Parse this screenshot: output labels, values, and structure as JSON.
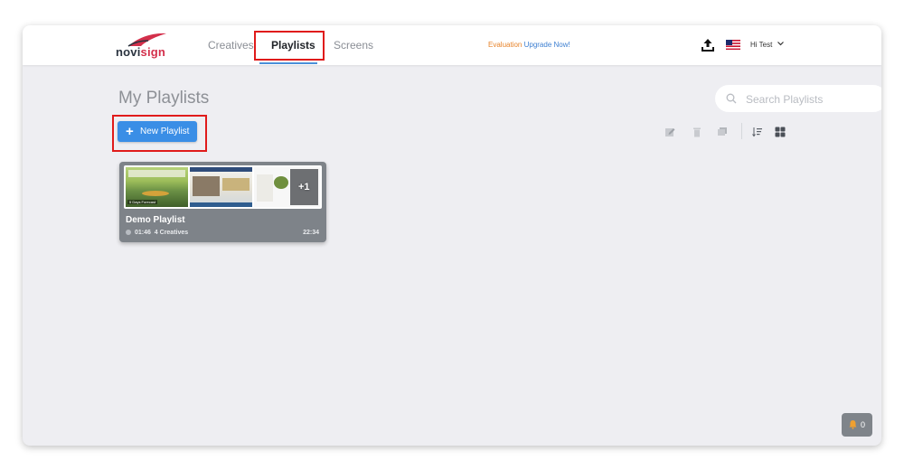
{
  "brand": {
    "logo_text_prefix": "novi",
    "logo_text_accent": "sign",
    "accent_color": "#d32f4b"
  },
  "nav": {
    "items": [
      {
        "label": "Creatives",
        "active": false
      },
      {
        "label": "Playlists",
        "active": true
      },
      {
        "label": "Screens",
        "active": false
      }
    ]
  },
  "evaluation": {
    "label": "Evaluation",
    "link": "Upgrade Now!"
  },
  "user": {
    "greeting": "Hi Test",
    "chevron": "chevron-down-icon"
  },
  "header_icons": [
    "upload-icon",
    "us-flag-icon"
  ],
  "page": {
    "title": "My Playlists",
    "search_placeholder": "Search Playlists",
    "new_button_label": "New Playlist",
    "toolbar_icons": [
      "edit-icon",
      "trash-icon",
      "duplicate-icon",
      "sort-icon",
      "grid-view-icon"
    ]
  },
  "playlists": [
    {
      "name": "Demo Playlist",
      "duration": "01:46",
      "creatives": "4 Creatives",
      "time": "22:34",
      "more_count": "+1",
      "thumb_caption": "5 Days Forecast"
    }
  ],
  "notifications": {
    "count": "0"
  },
  "colors": {
    "primary": "#3a8ee6",
    "highlight": "#e01b1b",
    "eval": "#e7842b",
    "card": "#7e8389"
  }
}
